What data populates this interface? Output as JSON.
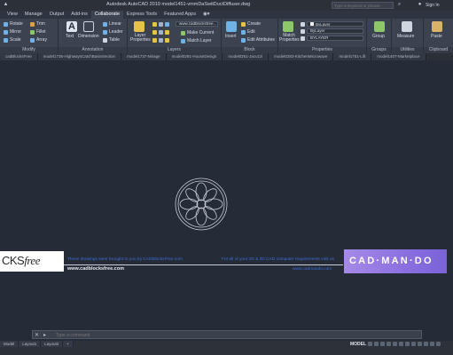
{
  "titlebar": {
    "title": "Autodesk AutoCAD 2019    model1451-vmmDaSwitDuctDiffuser.dwg",
    "search_placeholder": "Type a keyword or phrase",
    "sign_in": "Sign In"
  },
  "ribbon_tabs": [
    "View",
    "Manage",
    "Output",
    "Add-ins",
    "Collaborate",
    "Express Tools",
    "Featured Apps"
  ],
  "active_tab": "Collaborate",
  "ribbon": {
    "modify": {
      "title": "Modify",
      "buttons": [
        "Rotate",
        "Trim",
        "Mirror",
        "Fillet",
        "Scale",
        "Array"
      ]
    },
    "annotation": {
      "title": "Annotation",
      "text": "Text",
      "dimension": "Dimension",
      "linear": "Linear",
      "leader": "Leader",
      "table": "Table"
    },
    "layers": {
      "title": "Layers",
      "layer_properties": "Layer Properties",
      "layer_combo": "www.cadblocksfree...",
      "make_current": "Make Current",
      "match_layer": "Match Layer"
    },
    "block": {
      "title": "Block",
      "insert": "Insert",
      "create": "Create",
      "edit": "Edit",
      "edit_attributes": "Edit Attributes"
    },
    "properties": {
      "title": "Properties",
      "match_properties": "Match Properties",
      "color_combo": "ByLayer",
      "linetype_combo": "ByLayer",
      "lineweight_combo": "BYLAYER"
    },
    "groups": {
      "title": "Groups",
      "group": "Group"
    },
    "utilities": {
      "title": "Utilities",
      "measure": "Measure"
    },
    "clipboard": {
      "title": "Clipboard",
      "paste": "Paste"
    }
  },
  "file_tabs": [
    "cadBlocksFree",
    "model1735-HighwaysCatchBasinSection",
    "model1737-Mirage",
    "model0291-HouseDesign",
    "model0251-Jacuzzi",
    "model0283-KitchenMicrowave",
    "model1751-Lift",
    "model1407-Marketplace"
  ],
  "drawing": {
    "logo_left_main": "CKS",
    "logo_left_free": "free",
    "left_blue_note": "These drawings were brought to you by CADBlocksFree.com",
    "left_url": "www.cadblocksfree.com",
    "right_blue_note": "For all of your 2D & 3D CAD computer requirements visit us",
    "right_url": "www.cadmando.com",
    "cadmando_logo": "CAD·MAN·DO"
  },
  "command_line": {
    "close": "✕",
    "placeholder": "Type a command"
  },
  "statusbar": {
    "layout_tabs": [
      "Model",
      "Layout1",
      "Layout2",
      "+"
    ],
    "model": "MODEL"
  },
  "colors": {
    "canvas": "#252b37",
    "ribbon": "#3b4250",
    "link_blue": "#3b6fd6",
    "cadmando_purple": "#8b6fe0"
  }
}
